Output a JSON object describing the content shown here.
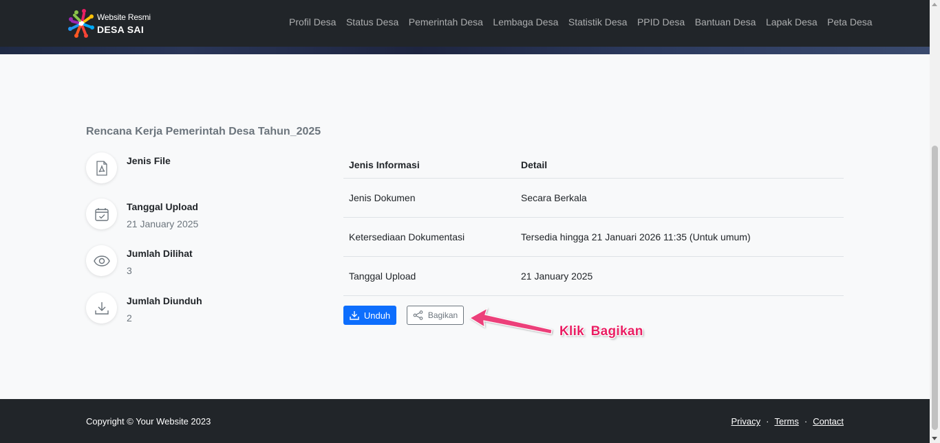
{
  "brand": {
    "subtitle": "Website Resmi",
    "title": "DESA SAI"
  },
  "nav": {
    "items": [
      "Profil Desa",
      "Status Desa",
      "Pemerintah Desa",
      "Lembaga Desa",
      "Statistik Desa",
      "PPID Desa",
      "Bantuan Desa",
      "Lapak Desa",
      "Peta Desa"
    ]
  },
  "document": {
    "title": "Rencana Kerja Pemerintah Desa Tahun_2025",
    "info": [
      {
        "label": "Jenis File",
        "value": "",
        "icon": "pdf-file-icon"
      },
      {
        "label": "Tanggal Upload",
        "value": "21 January 2025",
        "icon": "calendar-check-icon"
      },
      {
        "label": "Jumlah Dilihat",
        "value": "3",
        "icon": "eye-icon"
      },
      {
        "label": "Jumlah Diunduh",
        "value": "2",
        "icon": "download-icon"
      }
    ]
  },
  "table": {
    "headers": [
      "Jenis Informasi",
      "Detail"
    ],
    "rows": [
      [
        "Jenis Dokumen",
        "Secara Berkala"
      ],
      [
        "Ketersediaan Dokumentasi",
        "Tersedia hingga 21 Januari 2026 11:35 (Untuk umum)"
      ],
      [
        "Tanggal Upload",
        "21 January 2025"
      ]
    ]
  },
  "actions": {
    "download_label": "Unduh",
    "share_label": "Bagikan"
  },
  "annotation": {
    "text": "Klik  Bagikan",
    "color": "#e91e63"
  },
  "footer": {
    "copyright": "Copyright © Your Website 2023",
    "links": [
      "Privacy",
      "Terms",
      "Contact"
    ],
    "separator": "·"
  },
  "colors": {
    "navbar": "#212529",
    "primary": "#0d6efd",
    "muted": "#6c757d"
  }
}
